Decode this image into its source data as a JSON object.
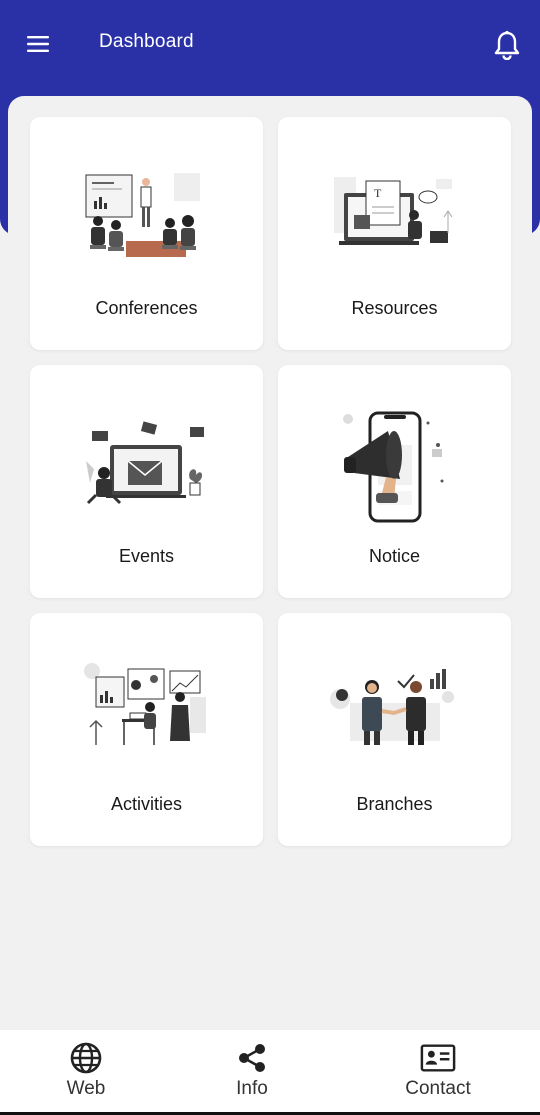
{
  "header": {
    "title": "Dashboard",
    "menu_icon": "hamburger-menu-icon",
    "bell_icon": "bell-icon",
    "color": "#2a31a6"
  },
  "cards": [
    {
      "label": "Conferences",
      "icon": "conference-illustration"
    },
    {
      "label": "Resources",
      "icon": "resources-illustration"
    },
    {
      "label": "Events",
      "icon": "events-illustration"
    },
    {
      "label": "Notice",
      "icon": "megaphone-phone-illustration"
    },
    {
      "label": "Activities",
      "icon": "activities-illustration"
    },
    {
      "label": "Branches",
      "icon": "handshake-illustration"
    }
  ],
  "bottom_nav": [
    {
      "label": "Web",
      "icon": "globe-icon"
    },
    {
      "label": "Info",
      "icon": "share-icon"
    },
    {
      "label": "Contact",
      "icon": "contact-card-icon"
    }
  ]
}
